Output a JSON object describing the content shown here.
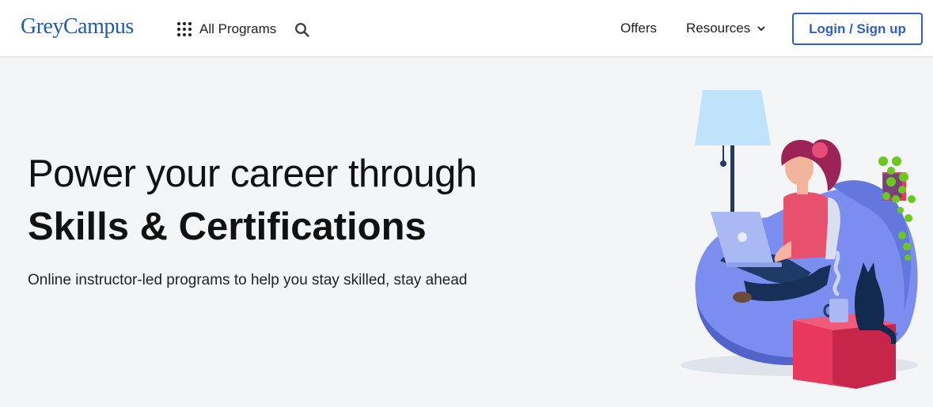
{
  "header": {
    "logo": "GreyCampus",
    "all_programs_label": "All Programs",
    "nav": {
      "offers": "Offers",
      "resources": "Resources"
    },
    "login_label": "Login / Sign up"
  },
  "hero": {
    "title_line1": "Power your career through",
    "title_line2": "Skills & Certifications",
    "subtitle": "Online instructor-led programs to help you stay skilled, stay ahead"
  },
  "icons": {
    "grid": "grid-icon",
    "search": "search-icon",
    "chevron": "chevron-down-icon"
  },
  "colors": {
    "brand": "#1a5cb8",
    "accent": "#2d5fcf",
    "background": "#f4f5f7"
  }
}
